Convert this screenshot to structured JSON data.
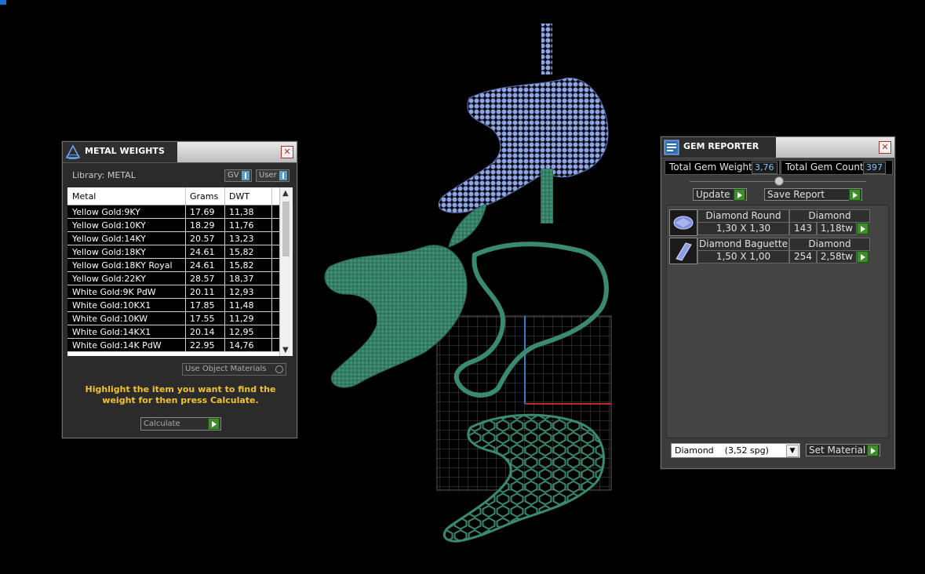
{
  "colors": {
    "accent_green": "#3d8d2a",
    "value_blue": "#7fc2ff",
    "hint_yellow": "#f1c232",
    "model_teal": "#3a8a70",
    "model_blue": "#8fa6e0"
  },
  "metal_weights": {
    "title": "METAL WEIGHTS",
    "library_label": "Library: METAL",
    "toggle_gv": "GV",
    "toggle_user": "User",
    "columns": [
      "Metal",
      "Grams",
      "DWT"
    ],
    "rows": [
      [
        "Yellow Gold:9KY",
        "17.69",
        "11,38"
      ],
      [
        "Yellow Gold:10KY",
        "18.29",
        "11,76"
      ],
      [
        "Yellow Gold:14KY",
        "20.57",
        "13,23"
      ],
      [
        "Yellow Gold:18KY",
        "24.61",
        "15,82"
      ],
      [
        "Yellow Gold:18KY Royal",
        "24.61",
        "15,82"
      ],
      [
        "Yellow Gold:22KY",
        "28.57",
        "18,37"
      ],
      [
        "White Gold:9K PdW",
        "20.11",
        "12,93"
      ],
      [
        "White Gold:10KX1",
        "17.85",
        "11,48"
      ],
      [
        "White Gold:10KW",
        "17.55",
        "11,29"
      ],
      [
        "White Gold:14KX1",
        "20.14",
        "12,95"
      ],
      [
        "White Gold:14K PdW",
        "22.95",
        "14,76"
      ]
    ],
    "use_object_materials": "Use Object Materials",
    "hint": "Highlight the item you want to find the weight for then press Calculate.",
    "calculate": "Calculate"
  },
  "gem_reporter": {
    "title": "GEM REPORTER",
    "total_weight_label": "Total Gem Weight",
    "total_weight_value": "3,76",
    "total_count_label": "Total Gem Count",
    "total_count_value": "397",
    "update": "Update",
    "save_report": "Save Report",
    "gems": [
      {
        "name": "Diamond Round",
        "material": "Diamond",
        "size": "1,30 X 1,30",
        "count": "143",
        "weight": "1,18tw"
      },
      {
        "name": "Diamond Baguette",
        "material": "Diamond",
        "size": "1,50 X 1,00",
        "count": "254",
        "weight": "2,58tw"
      }
    ],
    "material_select": "Diamond    (3,52 spg)",
    "set_material": "Set Material"
  }
}
